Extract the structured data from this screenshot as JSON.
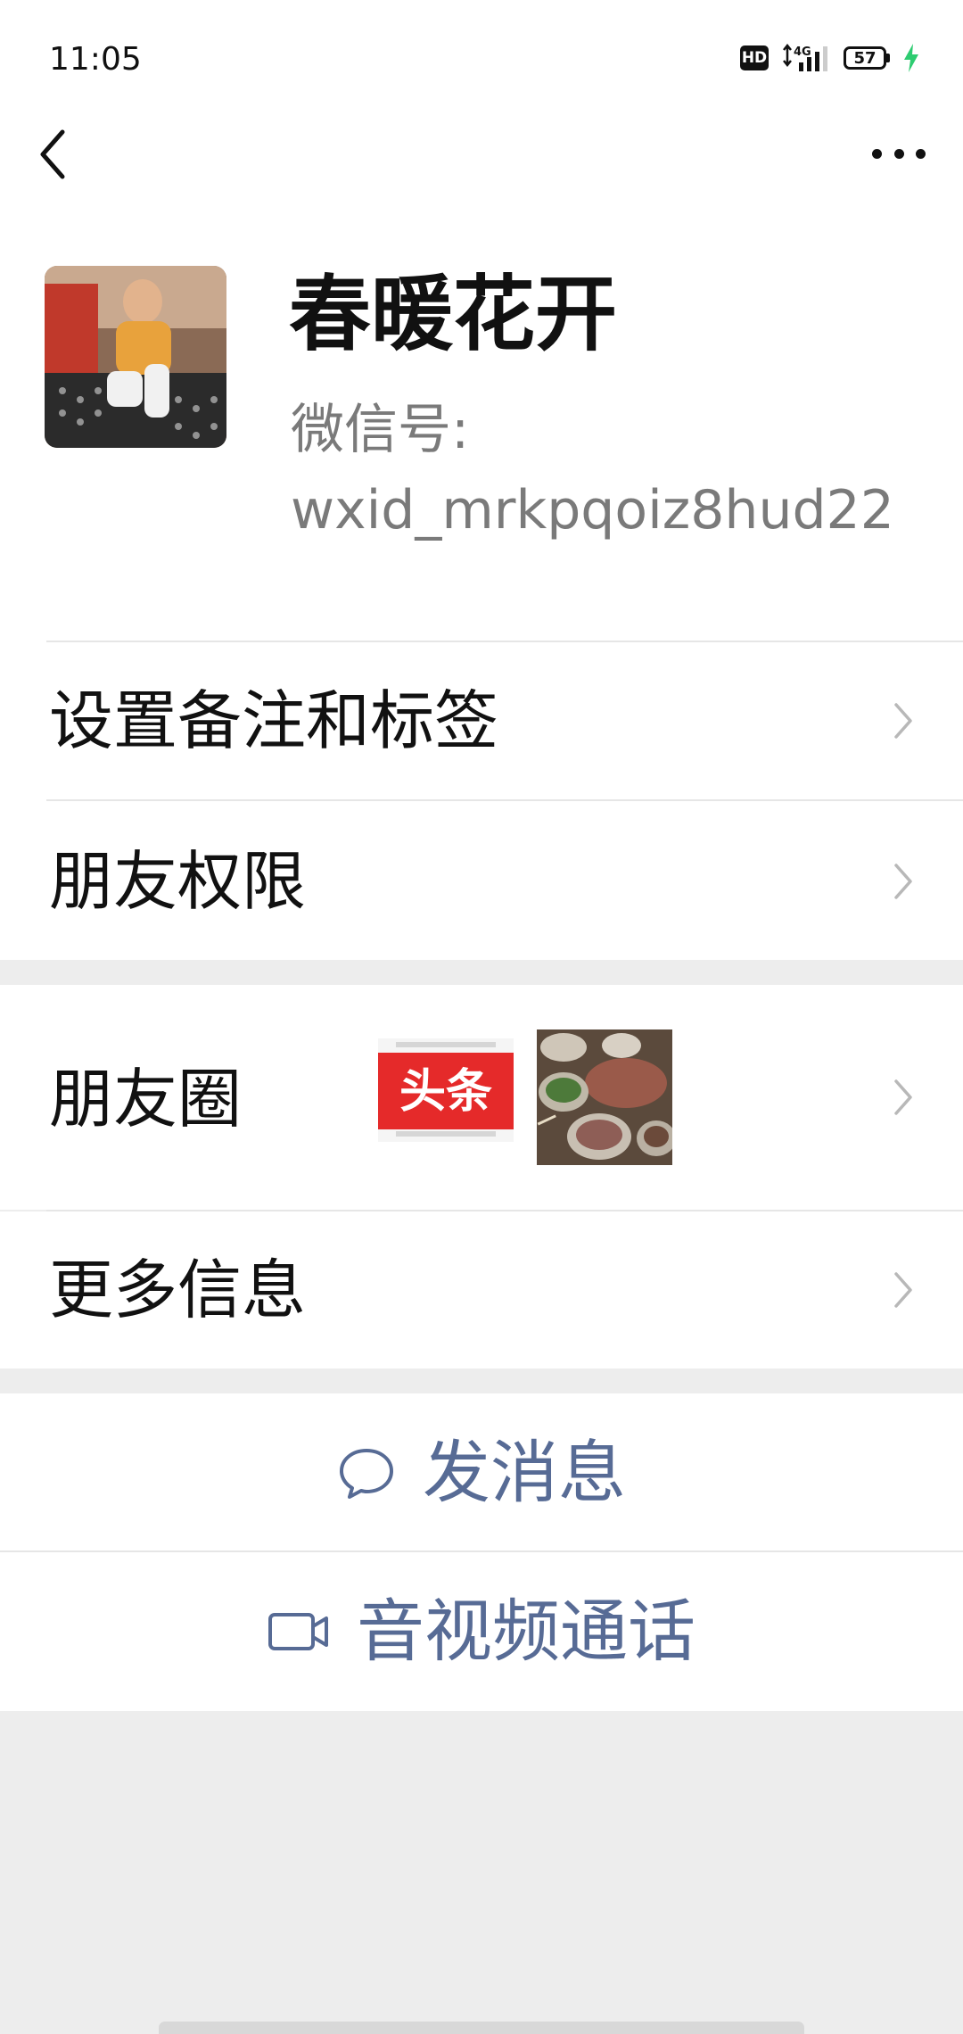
{
  "status_bar": {
    "time": "11:05",
    "hd_badge": "HD",
    "network": "4G",
    "battery": "57",
    "charging_color": "#2ecc71"
  },
  "nav": {
    "back_icon": "chevron-left-icon",
    "more_icon": "more-dots-icon"
  },
  "profile": {
    "nickname": "春暖花开",
    "wxid_label": "微信号:",
    "wxid_value": "wxid_mrkpqoiz8hud22"
  },
  "menu": {
    "remark": "设置备注和标签",
    "permissions": "朋友权限",
    "moments": "朋友圈",
    "more_info": "更多信息"
  },
  "moments_thumbs": {
    "toutiao_label": "头条"
  },
  "actions": {
    "message": "发消息",
    "call": "音视频通话"
  },
  "colors": {
    "link_blue": "#576b95",
    "background_gray": "#ededed",
    "toutiao_red": "#e52a2a"
  }
}
